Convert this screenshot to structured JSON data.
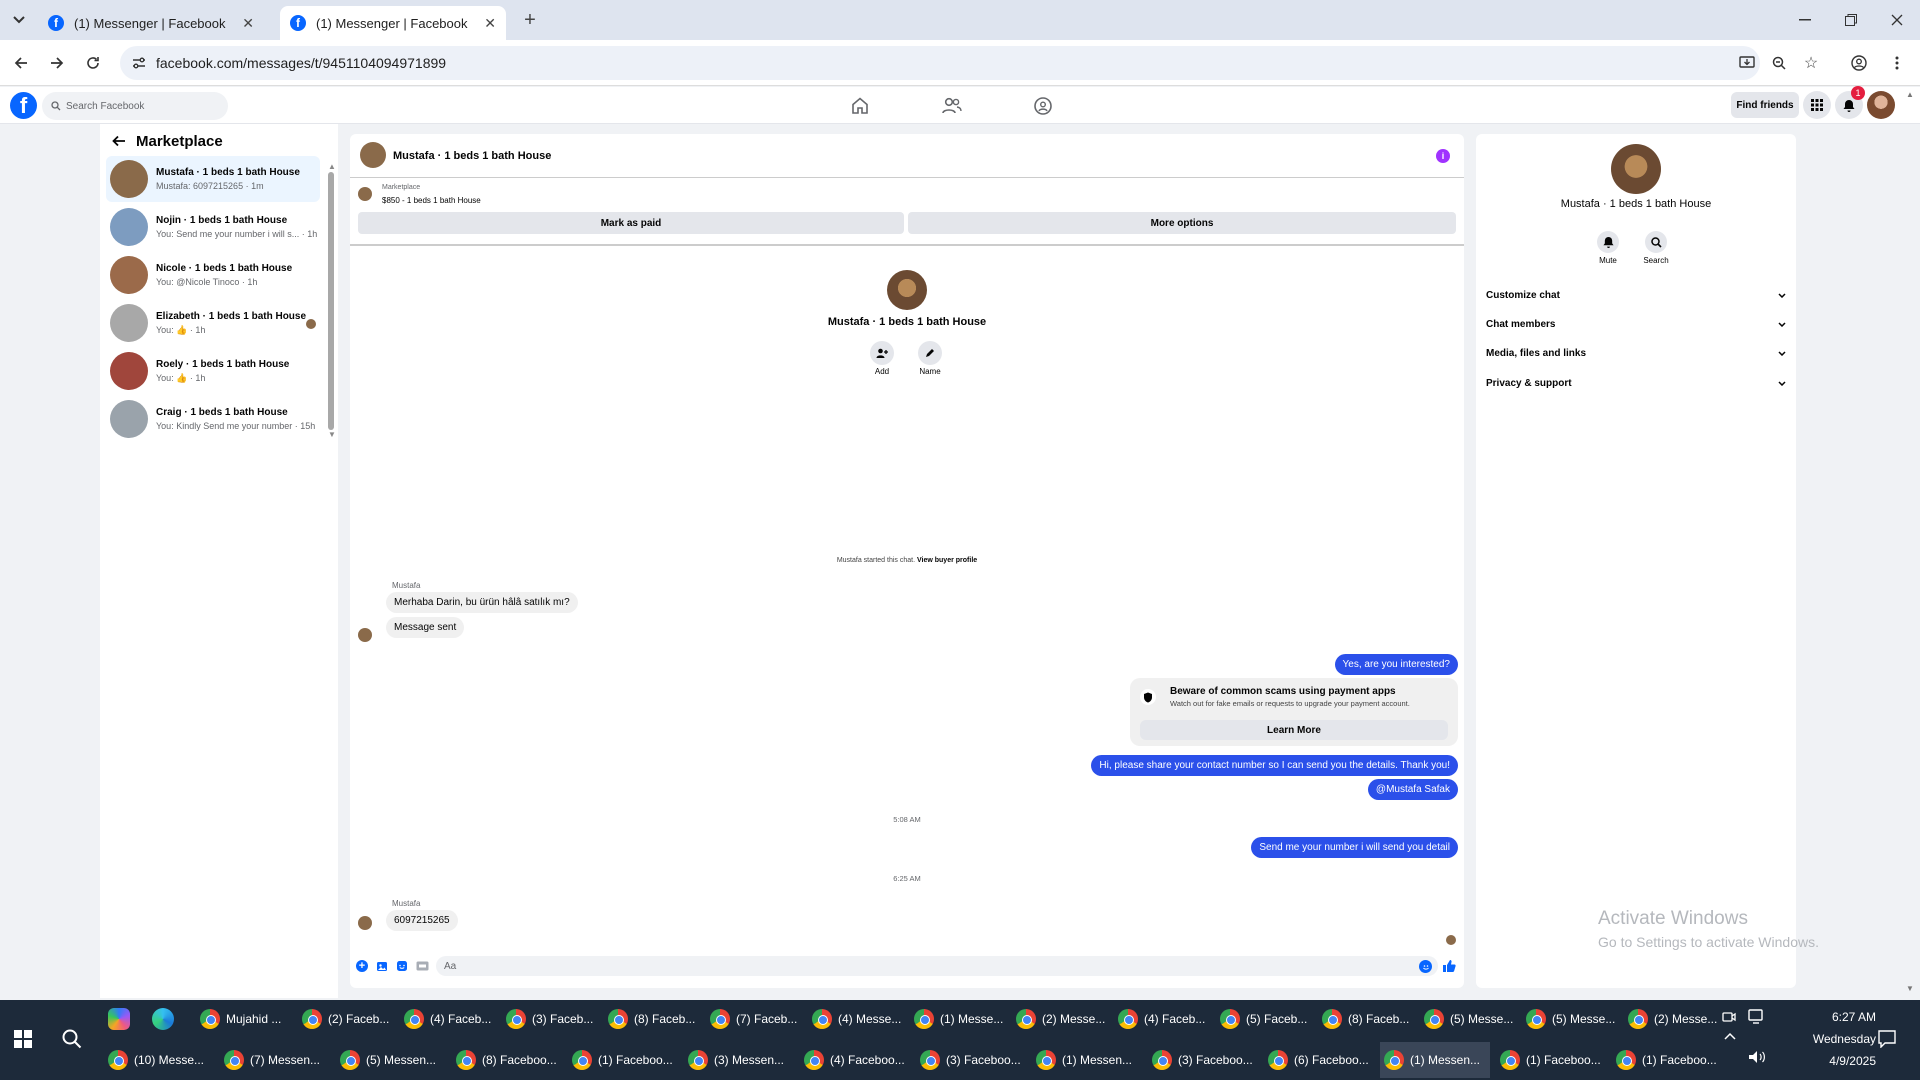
{
  "browser": {
    "tabs": [
      {
        "title": "(1) Messenger | Facebook"
      },
      {
        "title": "(1) Messenger | Facebook"
      }
    ],
    "url": "facebook.com/messages/t/9451104094971899"
  },
  "fb_header": {
    "search_placeholder": "Search Facebook",
    "find_friends": "Find friends",
    "notification_count": "1"
  },
  "sidebar": {
    "title": "Marketplace",
    "conversations": [
      {
        "title": "Mustafa · 1 beds 1 bath House",
        "sub": "Mustafa: 6097215265 · 1m",
        "color": "#8a6a4a"
      },
      {
        "title": "Nojin · 1 beds 1 bath House",
        "sub": "You: Send me your number i will s... · 1h",
        "color": "#7d9cc0"
      },
      {
        "title": "Nicole · 1 beds 1 bath House",
        "sub": "You: @Nicole Tinoco · 1h",
        "color": "#9b6a4a"
      },
      {
        "title": "Elizabeth · 1 beds 1 bath House",
        "sub": "You: 👍 · 1h",
        "color": "#a8a8a8"
      },
      {
        "title": "Roely · 1 beds 1 bath House",
        "sub": "You: 👍 · 1h",
        "color": "#a0463c"
      },
      {
        "title": "Craig · 1 beds 1 bath House",
        "sub": "You: Kindly Send me your number · 15h",
        "color": "#9aa3ab"
      }
    ]
  },
  "chat": {
    "header_title": "Mustafa · 1 beds 1 bath House",
    "listing_label": "Marketplace",
    "listing_price": "$850 - 1 beds 1 bath House",
    "mark_paid": "Mark as paid",
    "more_options": "More options",
    "profile_name": "Mustafa · 1 beds 1 bath House",
    "add_label": "Add",
    "name_label": "Name",
    "started_text": "Mustafa started this chat.",
    "view_buyer": "View buyer profile",
    "sender1": "Mustafa",
    "msg1": "Merhaba Darin, bu ürün hâlâ satılık mı?",
    "msg2": "Message sent",
    "out1": "Yes, are you interested?",
    "warning_title": "Beware of common scams using payment apps",
    "warning_sub": "Watch out for fake emails or requests to upgrade your payment account.",
    "learn_more": "Learn More",
    "out2": "Hi, please share your contact number so I can send you the details. Thank you!",
    "out3": "@Mustafa Safak",
    "time1": "5:08 AM",
    "out4": "Send me your number i will send you detail",
    "time2": "6:25 AM",
    "sender2": "Mustafa",
    "msg3": "6097215265",
    "composer_placeholder": "Aa"
  },
  "right_panel": {
    "name": "Mustafa · 1 beds 1 bath House",
    "mute": "Mute",
    "search": "Search",
    "sections": [
      "Customize chat",
      "Chat members",
      "Media, files and links",
      "Privacy & support"
    ]
  },
  "watermark": {
    "line1": "Activate Windows",
    "line2": "Go to Settings to activate Windows."
  },
  "taskbar": {
    "row1": [
      "Mujahid ...",
      "(2) Faceb...",
      "(4) Faceb...",
      "(3) Faceb...",
      "(8) Faceb...",
      "(7) Faceb...",
      "(4) Messe...",
      "(1) Messe...",
      "(2) Messe...",
      "(4) Faceb...",
      "(5) Faceb...",
      "(8) Faceb...",
      "(5) Messe...",
      "(5) Messe...",
      "(2) Messe..."
    ],
    "row2": [
      "(10) Messe...",
      "(7) Messen...",
      "(5) Messen...",
      "(8) Faceboo...",
      "(1) Faceboo...",
      "(3) Messen...",
      "(4) Faceboo...",
      "(3) Faceboo...",
      "(1) Messen...",
      "(3) Faceboo...",
      "(6) Faceboo...",
      "(1) Messen...",
      "(1) Faceboo...",
      "(1) Faceboo..."
    ],
    "time": "6:27 AM",
    "day": "Wednesday",
    "date": "4/9/2025"
  }
}
